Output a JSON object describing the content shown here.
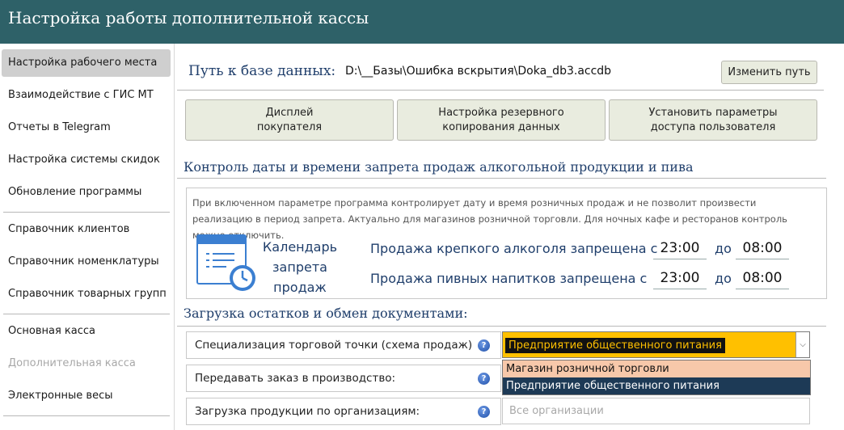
{
  "window": {
    "title": "Настройка работы дополнительной кассы"
  },
  "sidebar": {
    "items": [
      {
        "label": "Настройка рабочего места"
      },
      {
        "label": "Взаимодействие с ГИС МТ"
      },
      {
        "label": "Отчеты в Telegram"
      },
      {
        "label": "Настройка системы скидок"
      },
      {
        "label": "Обновление программы"
      },
      {
        "label": "Справочник клиентов"
      },
      {
        "label": "Справочник номенклатуры"
      },
      {
        "label": "Справочник товарных групп"
      },
      {
        "label": "Основная касса"
      },
      {
        "label": "Дополнительная касса"
      },
      {
        "label": "Электронные весы"
      }
    ]
  },
  "db": {
    "label": "Путь к базе данных:",
    "path": "D:\\__Базы\\Ошибка вскрытия\\Doka_db3.accdb",
    "change_button": "Изменить путь"
  },
  "buttons": {
    "display_line1": "Дисплей",
    "display_line2": "покупателя",
    "backup_line1": "Настройка резервного",
    "backup_line2": "копирования данных",
    "access_line1": "Установить параметры",
    "access_line2": "доступа пользователя"
  },
  "alcohol": {
    "title": "Контроль даты и времени запрета продаж алкогольной продукции и пива",
    "info": "При включенном параметре программа контролирует дату и время розничных продаж и не позволит произвести реализацию в период запрета. Актуально для магазинов розничной торговли. Для ночных кафе и ресторанов контроль можно отключить.",
    "calendar_line1": "Календарь",
    "calendar_line2": "запрета",
    "calendar_line3": "продаж",
    "strong_label": "Продажа крепкого алкоголя запрещена с",
    "strong_from": "23:00",
    "strong_to": "08:00",
    "beer_label": "Продажа пивных напитков запрещена с",
    "beer_from": "23:00",
    "beer_to": "08:00",
    "to_word": "до"
  },
  "exchange": {
    "title": "Загрузка остатков и обмен документами:",
    "specialization_label": "Специализация торговой точки (схема продаж)",
    "specialization_value": "Предприятие общественного питания",
    "options": [
      "Магазин розничной торговли",
      "Предприятие общественного питания"
    ],
    "production_label": "Передавать заказ в производство:",
    "orgs_label": "Загрузка продукции по организациям:",
    "orgs_value": "Все организации",
    "help_glyph": "?"
  }
}
